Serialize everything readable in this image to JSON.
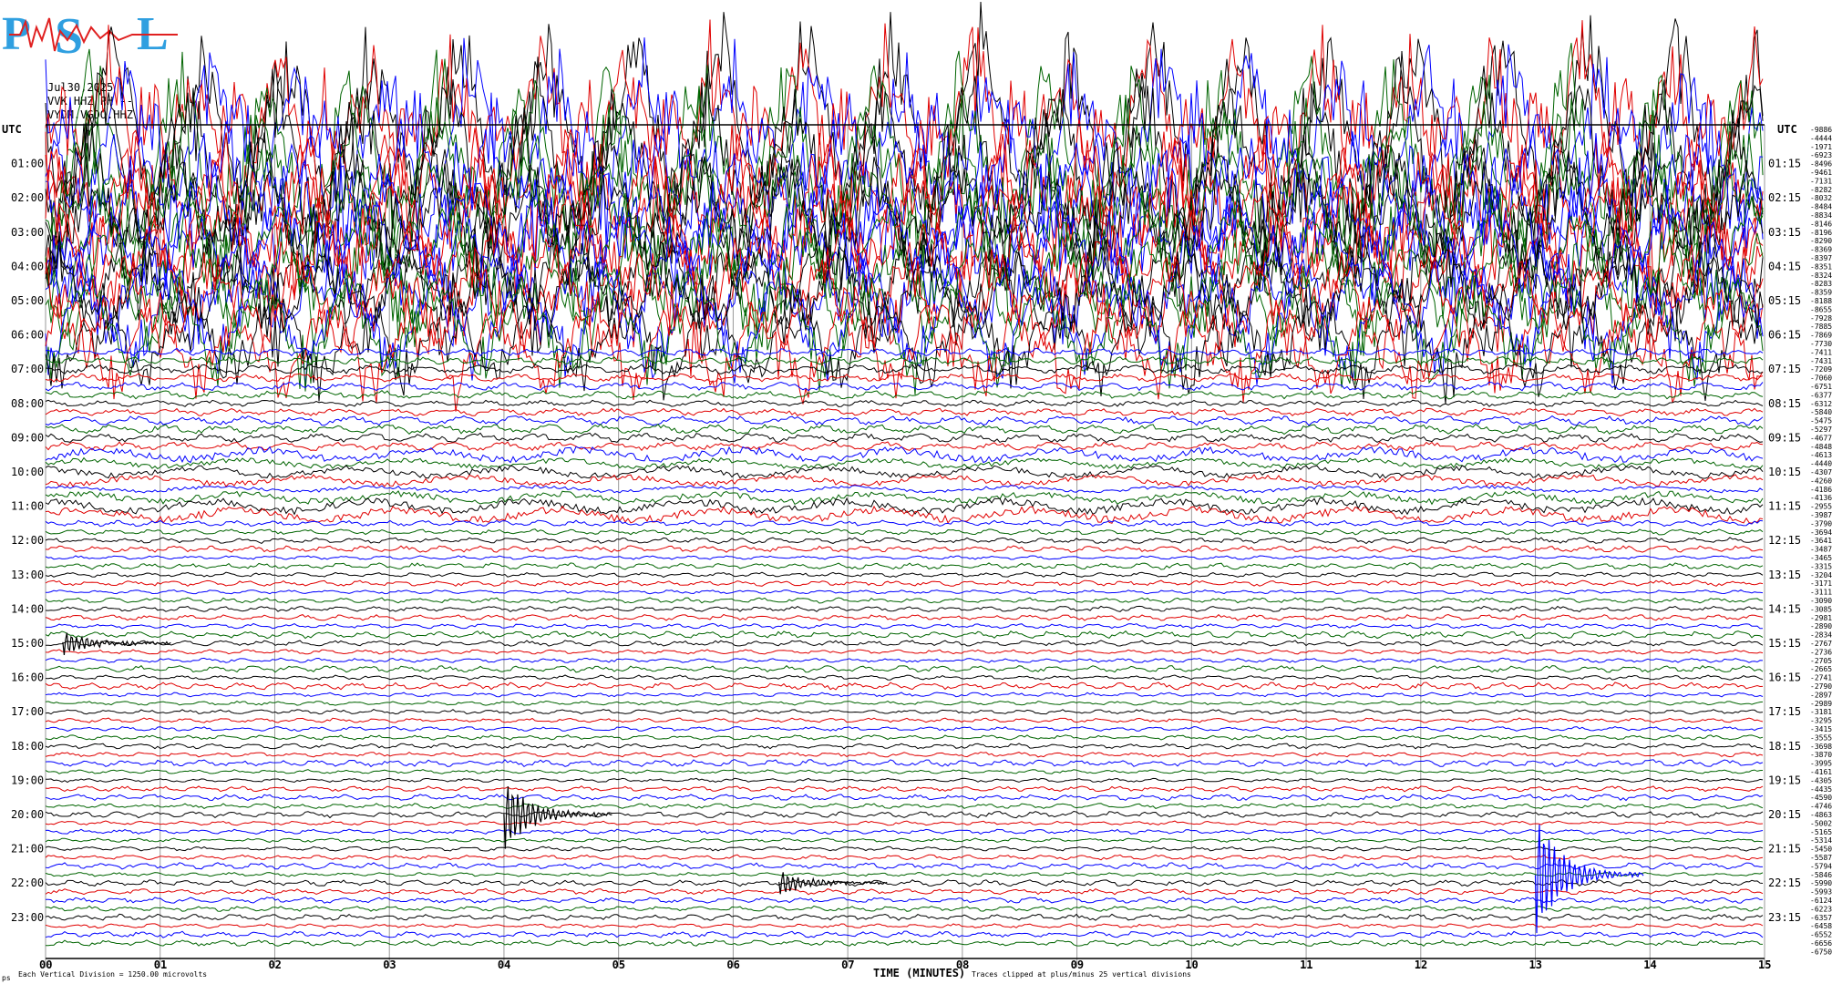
{
  "logo": {
    "text_left": "P",
    "text_mid": "S",
    "text_right": "L",
    "color_main": "#2f9fe0",
    "color_wave": "#e02020"
  },
  "header": {
    "date": "Jul30,2025",
    "channel": "VVK HHZ PH --",
    "station": "VYDM.VGDO.HHZ"
  },
  "axis": {
    "utc_left": "UTC",
    "utc_right": "UTC",
    "left_hours": [
      "01:00",
      "02:00",
      "03:00",
      "04:00",
      "05:00",
      "06:00",
      "07:00",
      "08:00",
      "09:00",
      "10:00",
      "11:00",
      "12:00",
      "13:00",
      "14:00",
      "15:00",
      "16:00",
      "17:00",
      "18:00",
      "19:00",
      "20:00",
      "21:00",
      "22:00",
      "23:00"
    ],
    "right_hours": [
      "01:15",
      "02:15",
      "03:15",
      "04:15",
      "05:15",
      "06:15",
      "07:15",
      "08:15",
      "09:15",
      "10:15",
      "11:15",
      "12:15",
      "13:15",
      "14:15",
      "15:15",
      "16:15",
      "17:15",
      "18:15",
      "19:15",
      "20:15",
      "21:15",
      "22:15",
      "23:15"
    ],
    "minutes": [
      "00",
      "01",
      "02",
      "03",
      "04",
      "05",
      "06",
      "07",
      "08",
      "09",
      "10",
      "11",
      "12",
      "13",
      "14",
      "15"
    ],
    "xlabel": "TIME (MINUTES)"
  },
  "footer": {
    "left_note": "Each Vertical Division = 1250.00 microvolts",
    "clip_note": "Traces clipped at plus/minus 25 vertical divisions",
    "corner": "ps"
  },
  "chart_data": {
    "type": "line",
    "title": "",
    "xlabel": "TIME (MINUTES)",
    "ylabel": "UTC",
    "xlim": [
      0,
      15
    ],
    "hours": 24,
    "traces_per_hour": 4,
    "trace_colors": [
      "#000000",
      "#e00000",
      "#0000ff",
      "#006400"
    ],
    "right_offsets": [
      -9886,
      -4444,
      -19711,
      -6923,
      -8496,
      -9461,
      -7131,
      -8282,
      -8032,
      -8484,
      -8834,
      -8146,
      -8196,
      -8290,
      -8369,
      -8397,
      -8351,
      -8324,
      -8283,
      -8359,
      -8188,
      -8655,
      -7928,
      -7885,
      -7869,
      -7730,
      -7411,
      -7431,
      -7209,
      -7060,
      -6751,
      -6377,
      -6312,
      -5840,
      -5475,
      -5297,
      -4677,
      -4848,
      -4613,
      -4440,
      -4307,
      -4260,
      -4186,
      -4136,
      -2955,
      -3987,
      -3790,
      -3694,
      -3641,
      -3487,
      -3465,
      -3315,
      -3204,
      -3171,
      -3111,
      -3090,
      -3085,
      -2981,
      -2890,
      -2834,
      -2767,
      -2736,
      -2705,
      -2665,
      -2741,
      -2790,
      -2897,
      -2989,
      -3181,
      -3295,
      -3415,
      -3555,
      -3698,
      -3870,
      -3995,
      -4161,
      -4305,
      -4435,
      -4590,
      -4746,
      -4863,
      -5002,
      -5165,
      -5314,
      -5450,
      -5587,
      -5794,
      -5846,
      -5990,
      -5993,
      -6124,
      -6223,
      -6357,
      -6458,
      -6552,
      -6656,
      -6750
    ],
    "events": [
      {
        "hour_label": "15:00",
        "minute": 0.15,
        "amplitude": "moderate"
      },
      {
        "hour_label": "20:00",
        "minute": 4.0,
        "amplitude": "large"
      },
      {
        "hour_label": "22:00",
        "minute": 6.4,
        "amplitude": "moderate"
      },
      {
        "hour_label": "21:45",
        "minute": 13.0,
        "amplitude": "very large"
      }
    ]
  }
}
